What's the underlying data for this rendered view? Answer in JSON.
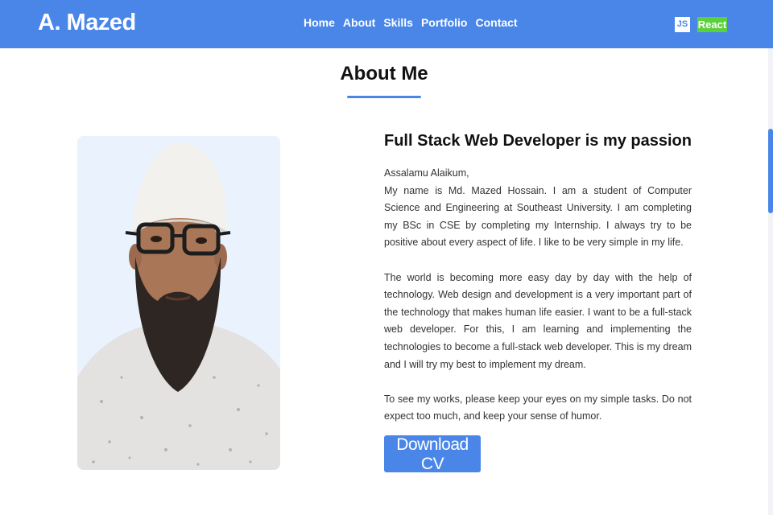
{
  "navbar": {
    "brand": "A. Mazed",
    "links": [
      "Home",
      "About",
      "Skills",
      "Portfolio",
      "Contact"
    ],
    "badges": {
      "js": "JS",
      "react": "React"
    },
    "colors": {
      "background": "#4a86e8",
      "react_badge": "#5ad13b"
    }
  },
  "about": {
    "title": "About Me",
    "heading": "Full Stack Web Developer is my passion",
    "greeting": "Assalamu Alaikum,",
    "paragraph1": "My name is Md. Mazed Hossain. I am a student of Computer Science and Engineering at Southeast University. I am completing my BSc in CSE by completing my Internship. I always try to be positive about every aspect of life. I like to be very simple in my life.",
    "paragraph2": "The world is becoming more easy day by day with the help of technology. Web design and development is a very important part of the technology that makes human life easier. I want to be a full-stack web developer. For this, I am learning and implementing the technologies to become a full-stack web developer. This is my dream and I will try my best to implement my dream.",
    "paragraph3": "To see my works, please keep your eyes on my simple tasks. Do not expect too much, and keep your sense of humor.",
    "button": "Download CV",
    "accent_color": "#4a86e8"
  }
}
